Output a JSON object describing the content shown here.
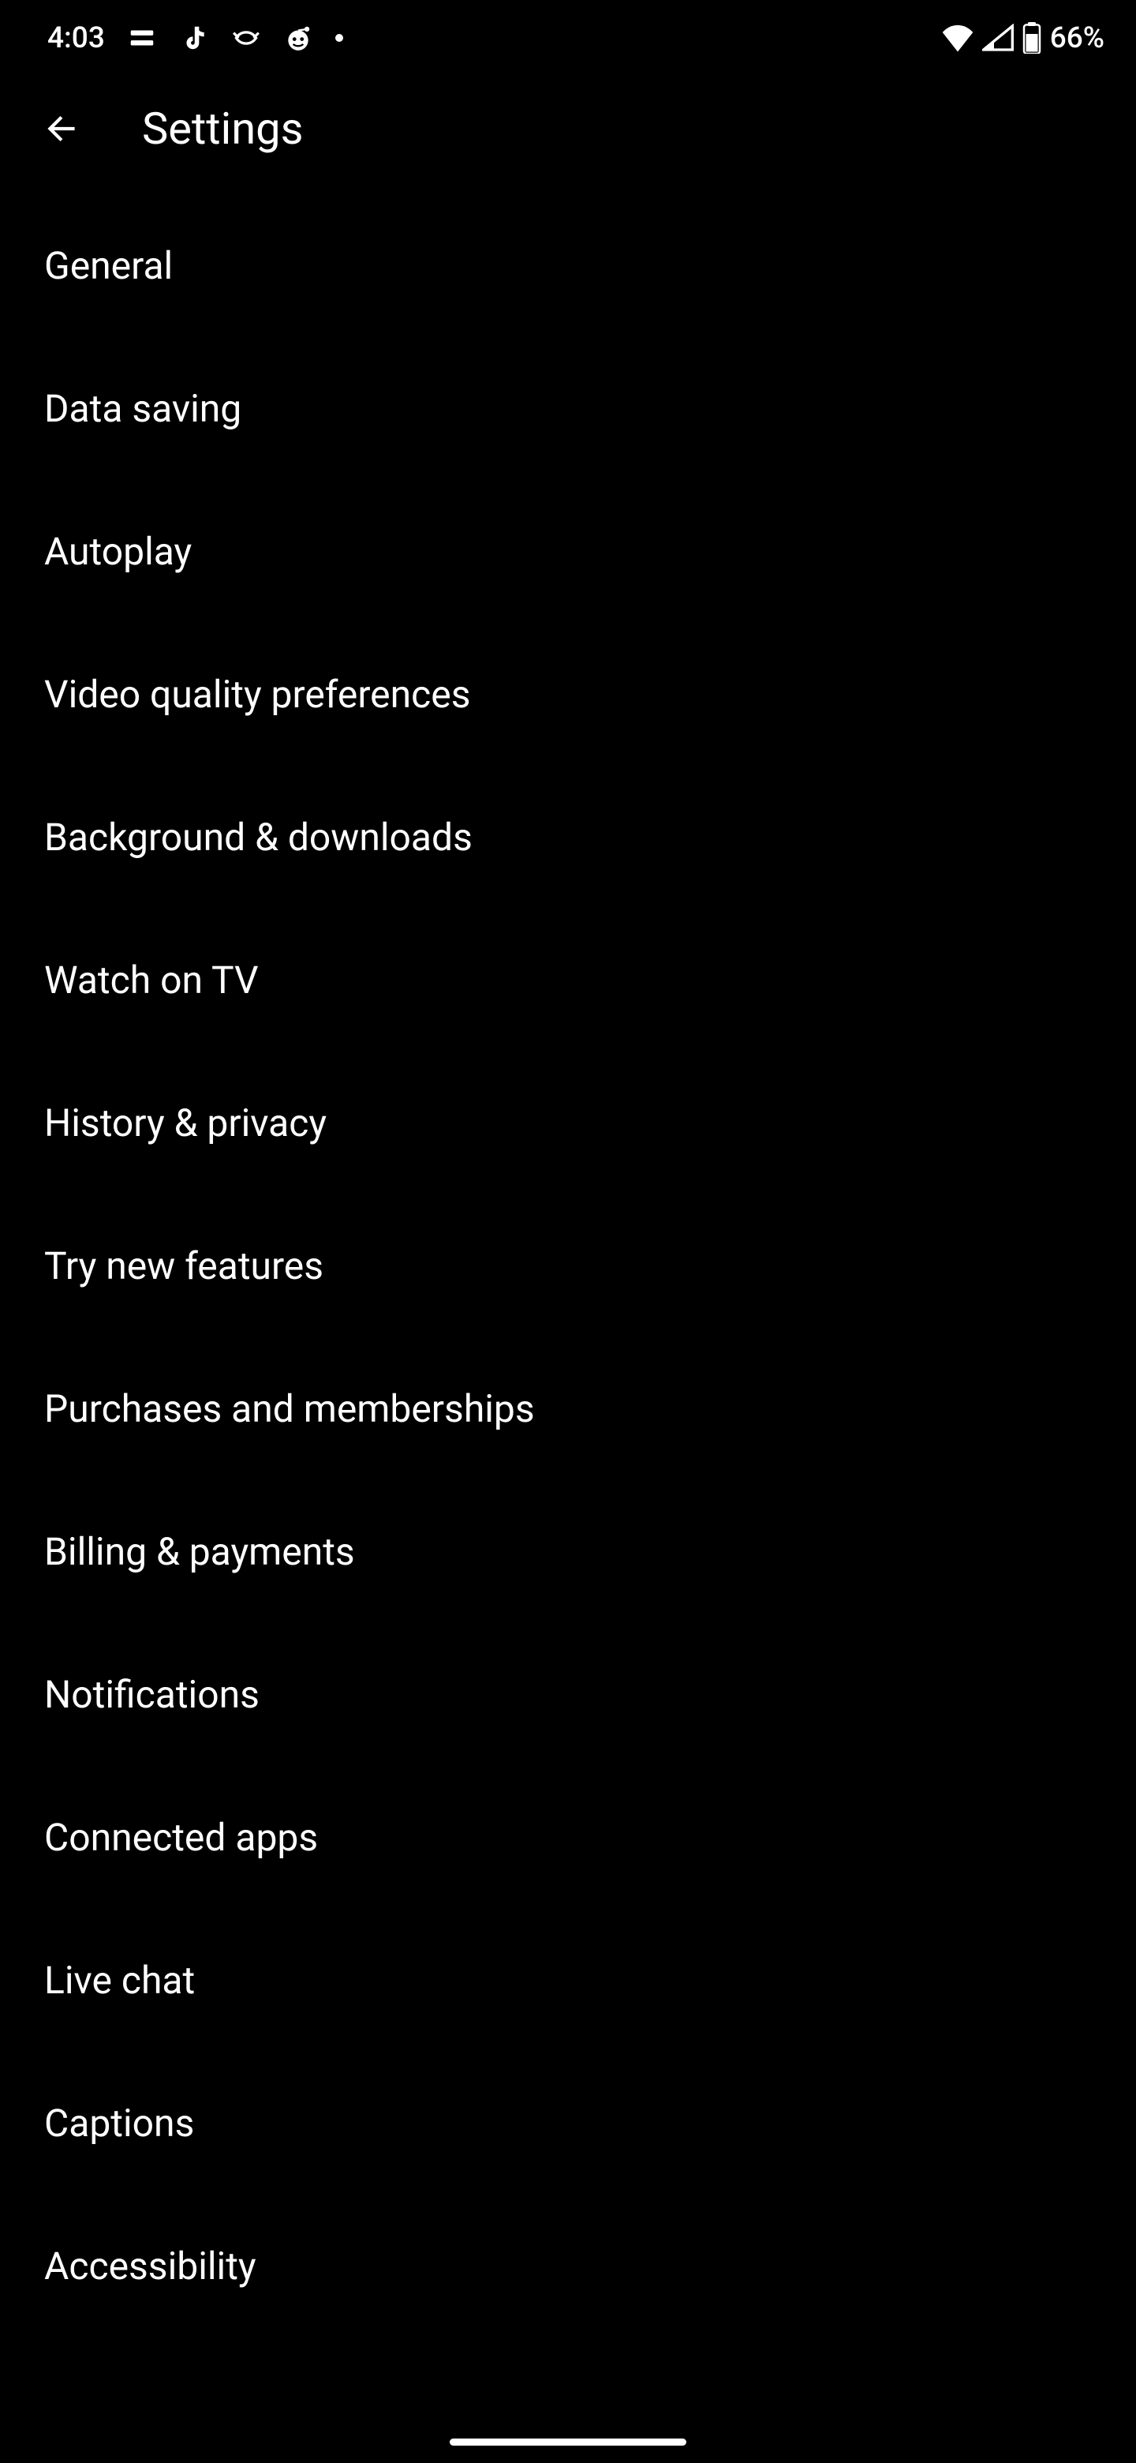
{
  "status_bar": {
    "time": "4:03",
    "battery_text": "66%",
    "app_icons": [
      "app-icon-1",
      "tiktok-icon",
      "app-icon-3",
      "reddit-icon"
    ],
    "system_icons": [
      "wifi-icon",
      "signal-icon",
      "battery-icon"
    ]
  },
  "header": {
    "title": "Settings"
  },
  "settings": {
    "items": [
      {
        "label": "General"
      },
      {
        "label": "Data saving"
      },
      {
        "label": "Autoplay"
      },
      {
        "label": "Video quality preferences"
      },
      {
        "label": "Background & downloads"
      },
      {
        "label": "Watch on TV"
      },
      {
        "label": "History & privacy"
      },
      {
        "label": "Try new features"
      },
      {
        "label": "Purchases and memberships"
      },
      {
        "label": "Billing & payments"
      },
      {
        "label": "Notifications"
      },
      {
        "label": "Connected apps"
      },
      {
        "label": "Live chat"
      },
      {
        "label": "Captions"
      },
      {
        "label": "Accessibility"
      }
    ]
  }
}
